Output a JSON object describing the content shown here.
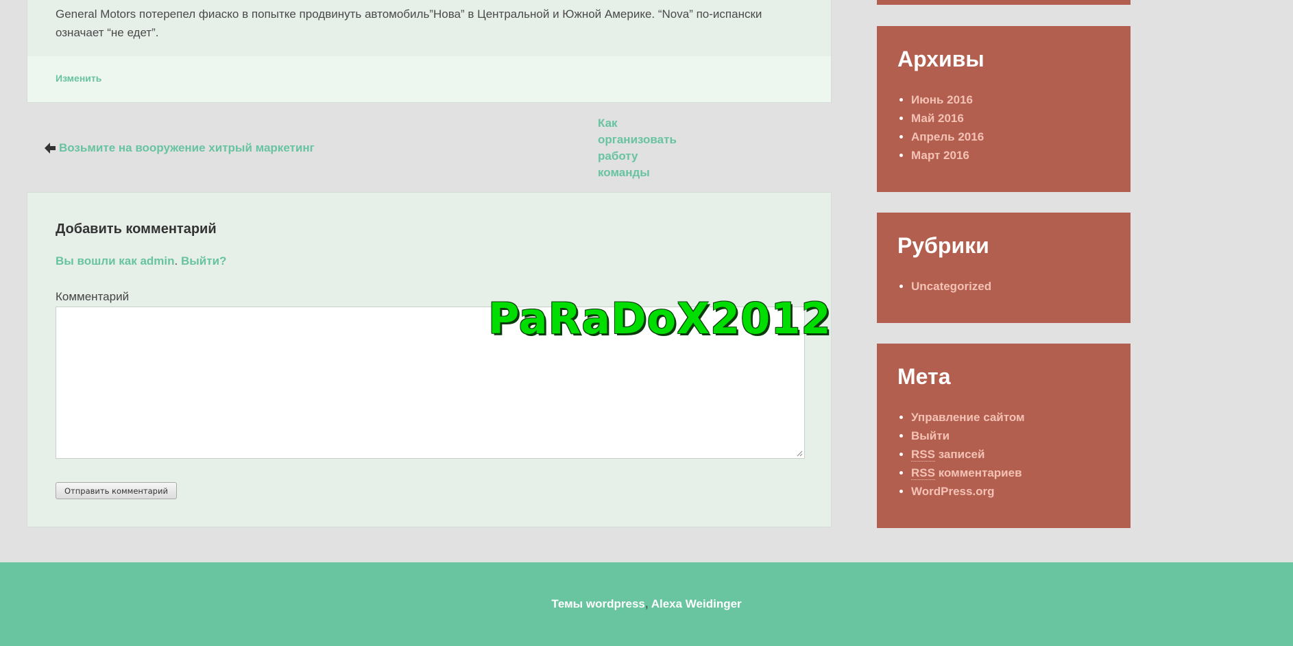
{
  "post": {
    "text": "General Motors потерепел фиаско в попытке продвинуть автомобиль”Нова” в Центральной и Южной Америке. “Nova” по-испански означает “не едет”.",
    "edit_label": "Изменить"
  },
  "post_nav": {
    "prev_label": "Возьмите на вооружение хитрый маркетинг",
    "next_label": "Как организовать работу команды"
  },
  "comment_form": {
    "title": "Добавить комментарий",
    "logged_in_prefix": "Вы вошли как admin",
    "logged_in_sep": ".",
    "logout_label": "Выйти?",
    "comment_label": "Комментарий",
    "comment_value": "",
    "submit_label": "Отправить комментарий"
  },
  "watermark": {
    "text": "PaRaDoX2012"
  },
  "sidebar": {
    "archives": {
      "title": "Архивы",
      "items": [
        "Июнь 2016",
        "Май 2016",
        "Апрель 2016",
        "Март 2016"
      ]
    },
    "categories": {
      "title": "Рубрики",
      "items": [
        "Uncategorized"
      ]
    },
    "meta": {
      "title": "Мета",
      "items": {
        "site_admin": "Управление сайтом",
        "logout": "Выйти",
        "rss_abbr": "RSS",
        "rss_posts_suffix": " записей",
        "rss_comments_suffix": " комментариев",
        "wordpress": "WordPress.org"
      }
    }
  },
  "footer": {
    "themes_label": "Темы wordpress",
    "separator": ", ",
    "author_label": "Alexa Weidinger"
  },
  "colors": {
    "accent": "#68c3a1",
    "widget_bg": "#b35f4f",
    "widget_link": "#f4c2b5",
    "footer_bg": "#68c5a0",
    "page_bg": "#e1e1e1"
  },
  "icons": {
    "prev": "arrow-left-icon",
    "next": "arrow-right-icon"
  }
}
